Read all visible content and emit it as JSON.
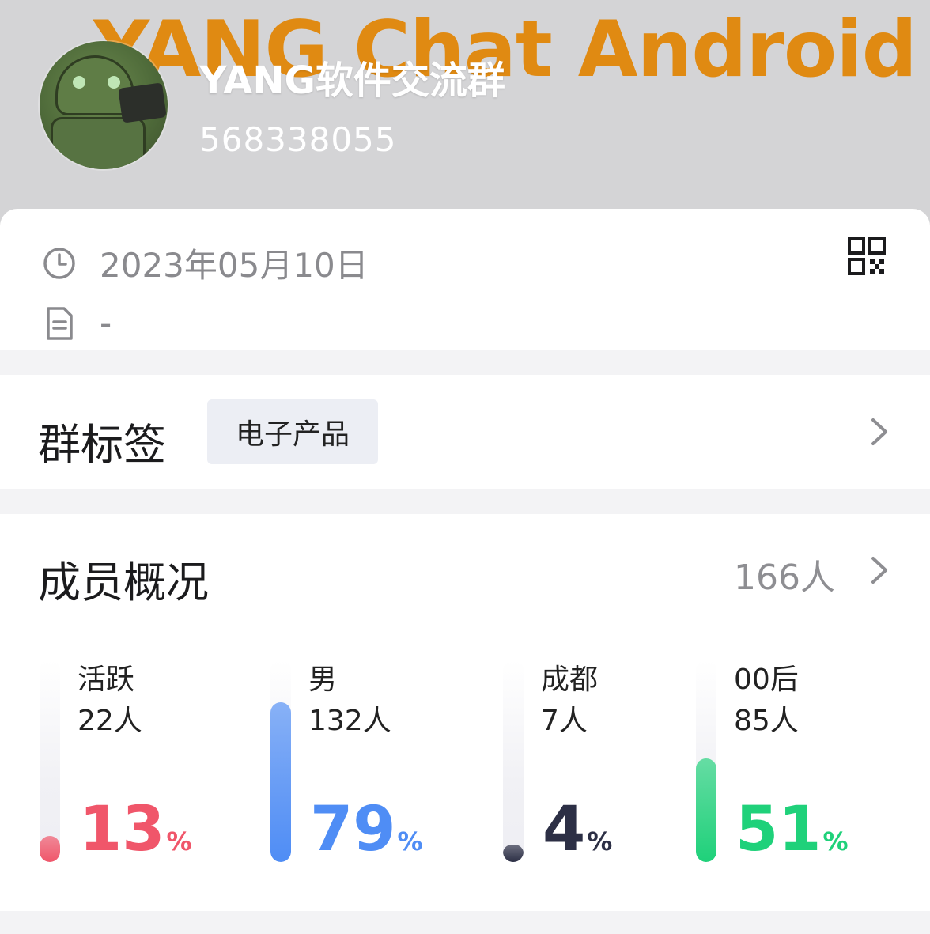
{
  "header": {
    "banner_text": "YANG Chat Android",
    "group_name": "YANG软件交流群",
    "group_id": "568338055"
  },
  "info": {
    "created_date": "2023年05月10日",
    "description": "-",
    "clock_icon": "clock-icon",
    "doc_icon": "document-icon",
    "qr_icon": "qr-code-icon"
  },
  "tags": {
    "title": "群标签",
    "items": [
      "电子产品"
    ]
  },
  "members": {
    "title": "成员概况",
    "count": "166人",
    "stats": [
      {
        "label": "活跃",
        "sub": "22人",
        "percent": "13",
        "fill_fraction": 0.13,
        "color": "#f0566a"
      },
      {
        "label": "男",
        "sub": "132人",
        "percent": "79",
        "fill_fraction": 0.79,
        "color": "#4f8df5"
      },
      {
        "label": "成都",
        "sub": "7人",
        "percent": "4",
        "fill_fraction": 0.04,
        "color": "#2c2f45"
      },
      {
        "label": "00后",
        "sub": "85人",
        "percent": "51",
        "fill_fraction": 0.51,
        "color": "#1fd17a"
      }
    ],
    "percent_sign": "%"
  }
}
